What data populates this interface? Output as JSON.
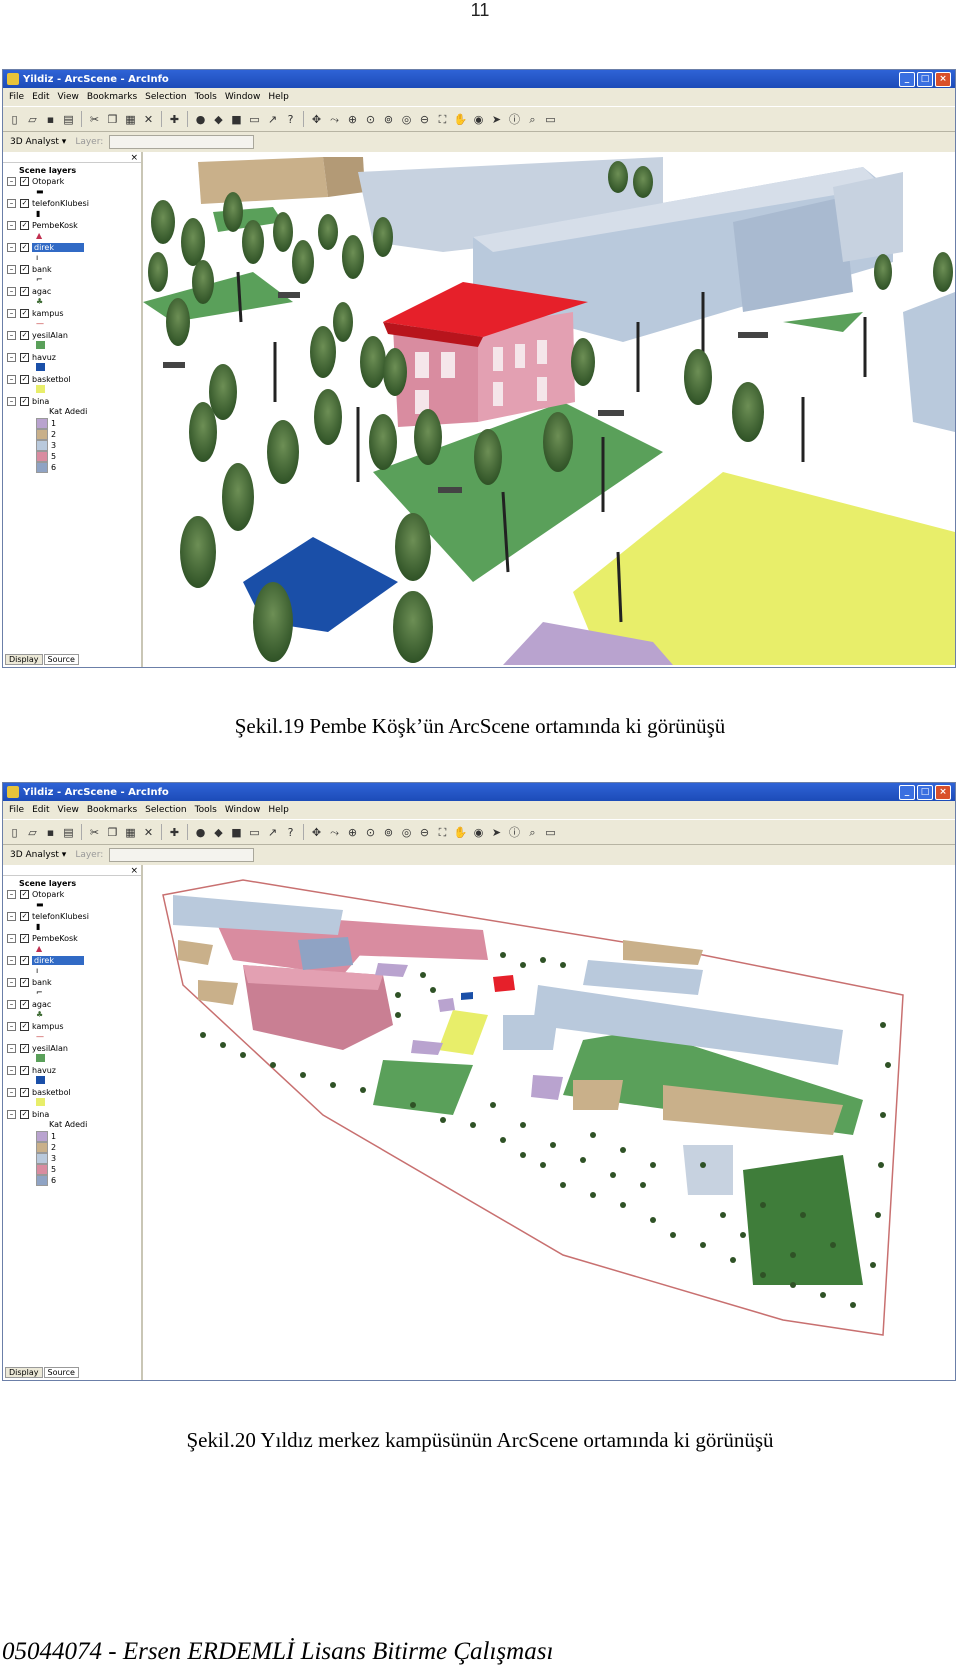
{
  "page_number": "11",
  "window": {
    "title": "Yildiz - ArcScene - ArcInfo",
    "menu": [
      "File",
      "Edit",
      "View",
      "Bookmarks",
      "Selection",
      "Tools",
      "Window",
      "Help"
    ],
    "analyst_label": "3D Analyst",
    "layer_label": "Layer:",
    "toc": {
      "title": "Scene layers",
      "layers": [
        "Otopark",
        "telefonKlubesi",
        "PembeKosk",
        "direk",
        "bank",
        "agac",
        "kampus",
        "yesilAlan",
        "havuz",
        "basketbol",
        "bina"
      ],
      "selected": "direk",
      "legend_title": "Kat Adedi",
      "legend": [
        {
          "label": "1",
          "color": "#b9a3cf"
        },
        {
          "label": "2",
          "color": "#c9b08a"
        },
        {
          "label": "3",
          "color": "#b9c9dc"
        },
        {
          "label": "5",
          "color": "#d98ca0"
        },
        {
          "label": "6",
          "color": "#8fa3c4"
        }
      ],
      "tabs": [
        "Display",
        "Source"
      ]
    }
  },
  "captions": {
    "fig19": "Şekil.19 Pembe Köşk’ün ArcScene ortamında ki görünüşü",
    "fig20": "Şekil.20 Yıldız merkez kampüsünün ArcScene ortamında ki görünüşü"
  },
  "footer": "05044074 - Ersen ERDEMLİ Lisans Bitirme Çalışması",
  "colors": {
    "pink_building": "#d98ca0",
    "red_roof": "#e6202a",
    "grass": "#5aa05a",
    "basketball": "#e8ee6a",
    "pool": "#1a4fa8",
    "tree": "#3c6a32",
    "grey_building": "#b9c9dc",
    "tan_building": "#c9b08a",
    "purple_building": "#b9a3cf"
  }
}
